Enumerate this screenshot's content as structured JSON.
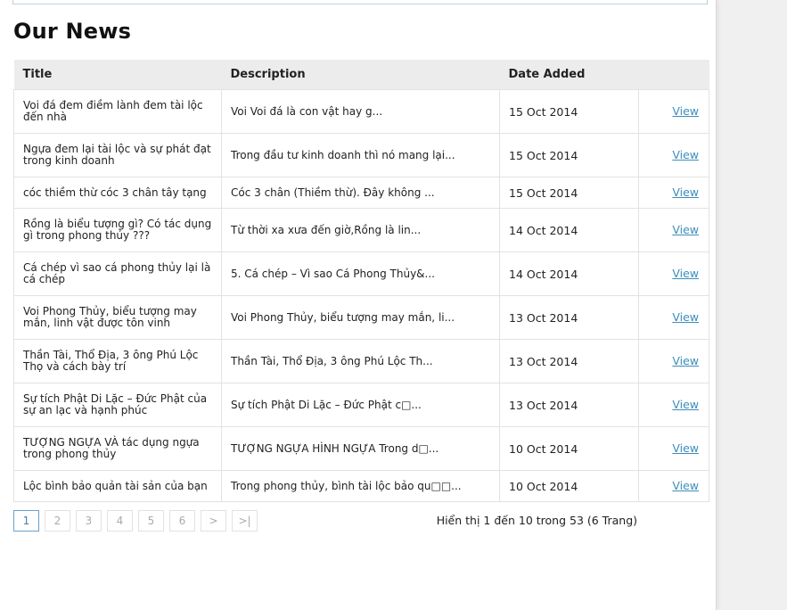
{
  "page_title": "Our News",
  "table": {
    "headers": [
      "Title",
      "Description",
      "Date Added",
      ""
    ],
    "rows": [
      {
        "title": "Voi đá đem điềm lành đem tài lộc đến nhà",
        "desc": "Voi   Voi đá là con vật hay g...",
        "date": "15 Oct 2014",
        "link": "View"
      },
      {
        "title": "Ngựa đem lại tài lộc và sự phát đạt trong kinh doanh",
        "desc": "Trong đầu tư kinh doanh thì nó mang lại...",
        "date": "15 Oct 2014",
        "link": "View"
      },
      {
        "title": "cóc thiềm thừ cóc 3 chân tây tạng",
        "desc": "Cóc 3 chân (Thiềm thừ). Đây không ...",
        "date": "15 Oct 2014",
        "link": "View"
      },
      {
        "title": "Rồng là biểu tượng gì? Có tác dụng gì trong phong thủy ???",
        "desc": "Từ thời xa xưa đến giờ,Rồng là lin...",
        "date": "14 Oct 2014",
        "link": "View"
      },
      {
        "title": "Cá chép vì sao cá phong thủy lại là cá chép",
        "desc": "5. Cá chép – Vì sao Cá Phong Thủy&...",
        "date": "14 Oct 2014",
        "link": "View"
      },
      {
        "title": "Voi Phong Thủy, biểu tượng may mắn, linh vật được tôn vinh",
        "desc": "Voi Phong Thủy, biểu tượng may mắn, li...",
        "date": "13 Oct 2014",
        "link": "View"
      },
      {
        "title": "Thần Tài, Thổ Địa, 3 ông Phú Lộc Thọ và cách bày trí",
        "desc": "Thần Tài, Thổ Địa, 3 ông Phú Lộc Th...",
        "date": "13 Oct 2014",
        "link": "View"
      },
      {
        "title": "Sự tích Phật Di Lặc – Đức Phật của sự an lạc và hạnh phúc",
        "desc": "Sự tích Phật Di Lặc – Đức Phật c□...",
        "date": "13 Oct 2014",
        "link": "View"
      },
      {
        "title": "TƯỢNG NGỰA VÀ tác dụng ngựa trong phong thủy",
        "desc": "TƯỢNG NGỰA HÌNH NGỰA  Trong d□...",
        "date": "10 Oct 2014",
        "link": "View"
      },
      {
        "title": "Lộc bình bảo quản tài sản của bạn",
        "desc": "Trong phong thủy, bình tài lộc bảo qu□□...",
        "date": "10 Oct 2014",
        "link": "View"
      }
    ]
  },
  "pagination": {
    "pages": [
      "1",
      "2",
      "3",
      "4",
      "5",
      "6",
      ">",
      ">|"
    ],
    "active": "1",
    "info": "Hiển thị 1 đến 10 trong 53 (6 Trang)"
  }
}
